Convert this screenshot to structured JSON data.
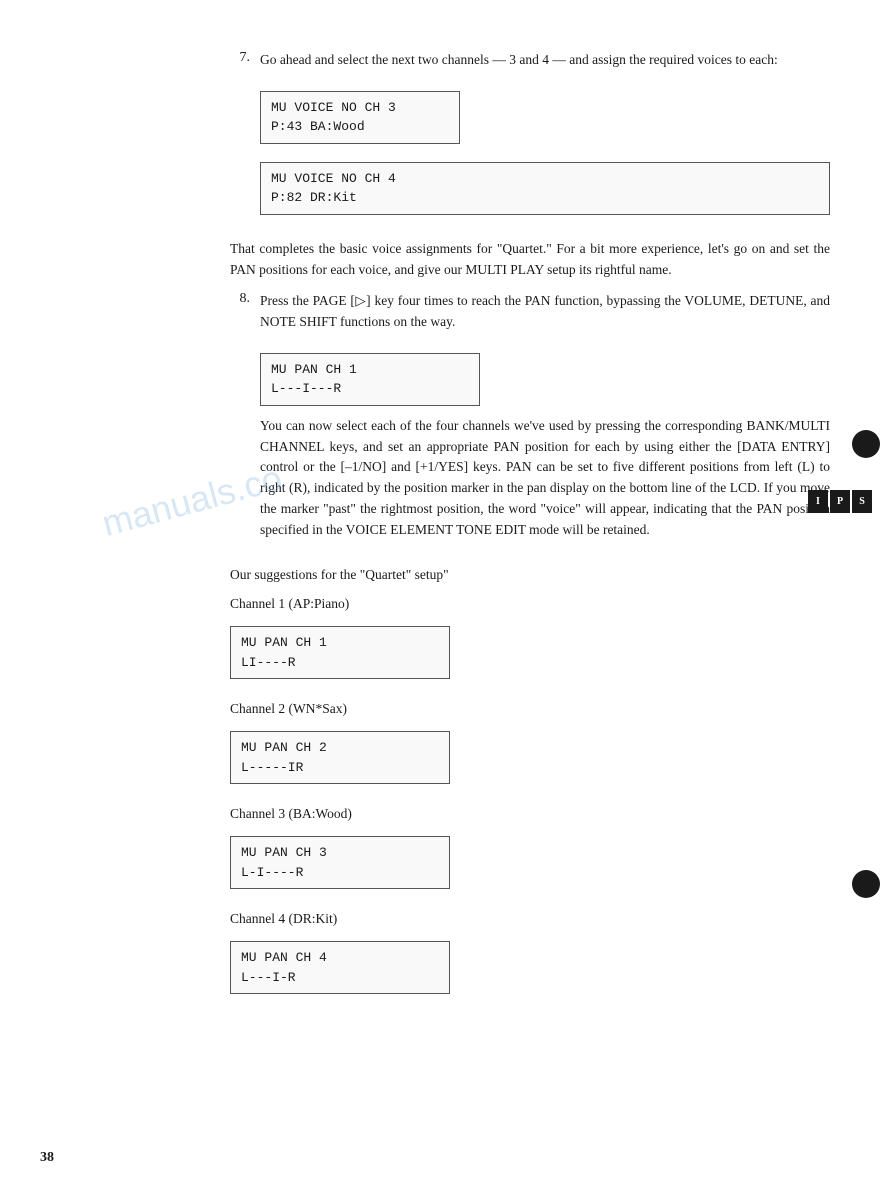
{
  "page": {
    "number": "38",
    "watermark": "manuals.co"
  },
  "side_label": {
    "lines": [
      "S",
      "P",
      "I"
    ]
  },
  "content": {
    "item7": {
      "number": "7.",
      "text": "Go ahead and select the next two channels — 3 and 4 — and assign the required voices to each:"
    },
    "lcd1": {
      "line1": "MU VOICE NO CH 3",
      "line2": "P:43  BA:Wood"
    },
    "lcd2": {
      "line1": "MU VOICE NO CH 4",
      "line2": "P:82  DR:Kit"
    },
    "para1": "That completes the basic voice assignments for \"Quartet.\" For a bit more experience, let's go on and set the PAN positions for each voice, and give our MULTI PLAY setup its rightful name.",
    "item8": {
      "number": "8.",
      "text": "Press the PAGE [▷] key four times to reach the PAN function, bypassing the VOLUME, DETUNE, and NOTE SHIFT functions on the way."
    },
    "lcd3": {
      "line1": "MU PAN       CH 1",
      "line2": "L---I---R"
    },
    "para2": "You can now select each of the four channels we've used by pressing the corresponding BANK/MULTI CHANNEL keys, and set an appropriate PAN position for each by using either the [DATA ENTRY] control or the [–1/NO] and [+1/YES] keys. PAN can be set to five different positions from left (L) to right (R), indicated by the position marker in the pan display on the bottom line of the LCD. If you move the marker \"past\" the rightmost position, the word \"voice\" will appear, indicating that the PAN position specified in the VOICE ELEMENT TONE EDIT mode will be retained.",
    "suggestions_label": "Our suggestions for the \"Quartet\" setup\"",
    "channels": [
      {
        "label": "Channel 1 (AP:Piano)",
        "lcd_line1": "MU PAN       CH 1",
        "lcd_line2": "LI----R"
      },
      {
        "label": "Channel 2 (WN*Sax)",
        "lcd_line1": "MU PAN       CH 2",
        "lcd_line2": "L-----IR"
      },
      {
        "label": "Channel 3 (BA:Wood)",
        "lcd_line1": "MU PAN       CH 3",
        "lcd_line2": "L-I----R"
      },
      {
        "label": "Channel 4 (DR:Kit)",
        "lcd_line1": "MU PAN       CH 4",
        "lcd_line2": "L---I-R"
      }
    ]
  }
}
